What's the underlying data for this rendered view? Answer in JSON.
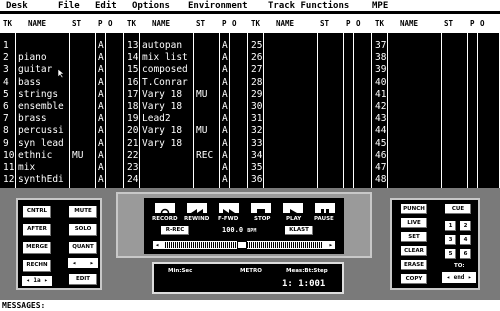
{
  "menu": [
    "Desk",
    "File",
    "Edit",
    "Options",
    "Environment",
    "Track Functions",
    "MPE"
  ],
  "columns": {
    "tk": "TK",
    "name": "NAME",
    "st": "ST",
    "p": "P",
    "o": "O"
  },
  "tracks": [
    [
      {
        "tk": "1",
        "name": "",
        "st": "",
        "p": "A"
      },
      {
        "tk": "2",
        "name": "piano",
        "st": "",
        "p": "A"
      },
      {
        "tk": "3",
        "name": "guitar",
        "st": "",
        "p": "A"
      },
      {
        "tk": "4",
        "name": "bass",
        "st": "",
        "p": "A"
      },
      {
        "tk": "5",
        "name": "strings",
        "st": "",
        "p": "A"
      },
      {
        "tk": "6",
        "name": "ensemble",
        "st": "",
        "p": "A"
      },
      {
        "tk": "7",
        "name": "brass",
        "st": "",
        "p": "A"
      },
      {
        "tk": "8",
        "name": "percussi",
        "st": "",
        "p": "A"
      },
      {
        "tk": "9",
        "name": "syn lead",
        "st": "",
        "p": "A"
      },
      {
        "tk": "10",
        "name": "ethnic",
        "st": "MU",
        "p": "A"
      },
      {
        "tk": "11",
        "name": "mix",
        "st": "",
        "p": "A"
      },
      {
        "tk": "12",
        "name": "synthEdi",
        "st": "",
        "p": "A"
      }
    ],
    [
      {
        "tk": "13",
        "name": "autopan",
        "st": "",
        "p": "A"
      },
      {
        "tk": "14",
        "name": "mix list",
        "st": "",
        "p": "A"
      },
      {
        "tk": "15",
        "name": "composed",
        "st": "",
        "p": "A"
      },
      {
        "tk": "16",
        "name": "T.Conrar",
        "st": "",
        "p": "A"
      },
      {
        "tk": "17",
        "name": "Vary 18",
        "st": "MU",
        "p": "A"
      },
      {
        "tk": "18",
        "name": "Vary 18",
        "st": "",
        "p": "A"
      },
      {
        "tk": "19",
        "name": "Lead2",
        "st": "",
        "p": "A"
      },
      {
        "tk": "20",
        "name": "Vary 18",
        "st": "MU",
        "p": "A"
      },
      {
        "tk": "21",
        "name": "Vary 18",
        "st": "",
        "p": "A"
      },
      {
        "tk": "22",
        "name": "",
        "st": "REC",
        "p": "A"
      },
      {
        "tk": "23",
        "name": "",
        "st": "",
        "p": "A"
      },
      {
        "tk": "24",
        "name": "",
        "st": "",
        "p": "A"
      }
    ],
    [
      {
        "tk": "25",
        "name": "",
        "st": "",
        "p": ""
      },
      {
        "tk": "26",
        "name": "",
        "st": "",
        "p": ""
      },
      {
        "tk": "27",
        "name": "",
        "st": "",
        "p": ""
      },
      {
        "tk": "28",
        "name": "",
        "st": "",
        "p": ""
      },
      {
        "tk": "29",
        "name": "",
        "st": "",
        "p": ""
      },
      {
        "tk": "30",
        "name": "",
        "st": "",
        "p": ""
      },
      {
        "tk": "31",
        "name": "",
        "st": "",
        "p": ""
      },
      {
        "tk": "32",
        "name": "",
        "st": "",
        "p": ""
      },
      {
        "tk": "33",
        "name": "",
        "st": "",
        "p": ""
      },
      {
        "tk": "34",
        "name": "",
        "st": "",
        "p": ""
      },
      {
        "tk": "35",
        "name": "",
        "st": "",
        "p": ""
      },
      {
        "tk": "36",
        "name": "",
        "st": "",
        "p": ""
      }
    ],
    [
      {
        "tk": "37",
        "name": "",
        "st": "",
        "p": ""
      },
      {
        "tk": "38",
        "name": "",
        "st": "",
        "p": ""
      },
      {
        "tk": "39",
        "name": "",
        "st": "",
        "p": ""
      },
      {
        "tk": "40",
        "name": "",
        "st": "",
        "p": ""
      },
      {
        "tk": "41",
        "name": "",
        "st": "",
        "p": ""
      },
      {
        "tk": "42",
        "name": "",
        "st": "",
        "p": ""
      },
      {
        "tk": "43",
        "name": "",
        "st": "",
        "p": ""
      },
      {
        "tk": "44",
        "name": "",
        "st": "",
        "p": ""
      },
      {
        "tk": "45",
        "name": "",
        "st": "",
        "p": ""
      },
      {
        "tk": "46",
        "name": "",
        "st": "",
        "p": ""
      },
      {
        "tk": "47",
        "name": "",
        "st": "",
        "p": ""
      },
      {
        "tk": "48",
        "name": "",
        "st": "",
        "p": ""
      }
    ]
  ],
  "left_panel": {
    "cntrl": "CNTRL",
    "after": "AFTER",
    "merge": "MERGE",
    "rechn": "RECHN",
    "mute": "MUTE",
    "solo": "SOLO",
    "quant": "QUANT",
    "edit": "EDIT",
    "channel": "1a"
  },
  "transport": {
    "record": "RECORD",
    "rewind": "REWIND",
    "ffwd": "F-FWD",
    "stop": "STOP",
    "play": "PLAY",
    "pause": "PAUSE",
    "rrec": "R-REC",
    "tempo": "100.0",
    "tempo_unit": "BPM",
    "klast": "KLAST"
  },
  "counter": {
    "minsec_label": "Min:Sec",
    "metro_label": "METRO",
    "meas_label": "Meas:Bt:Step",
    "position": "1: 1:001"
  },
  "right_panel": {
    "punch": "PUNCH",
    "live": "LIVE",
    "set": "SET",
    "clear": "CLEAR",
    "erase": "ERASE",
    "copy": "COPY",
    "cue": "CUE",
    "cue_nums": [
      "1",
      "2",
      "3",
      "4",
      "5",
      "6"
    ],
    "to_label": "TO:",
    "to_value": "end"
  },
  "messages_label": "MESSAGES:",
  "colors": {
    "background": "#000000",
    "panel": "#7a7a7a",
    "text": "#ffffff"
  }
}
